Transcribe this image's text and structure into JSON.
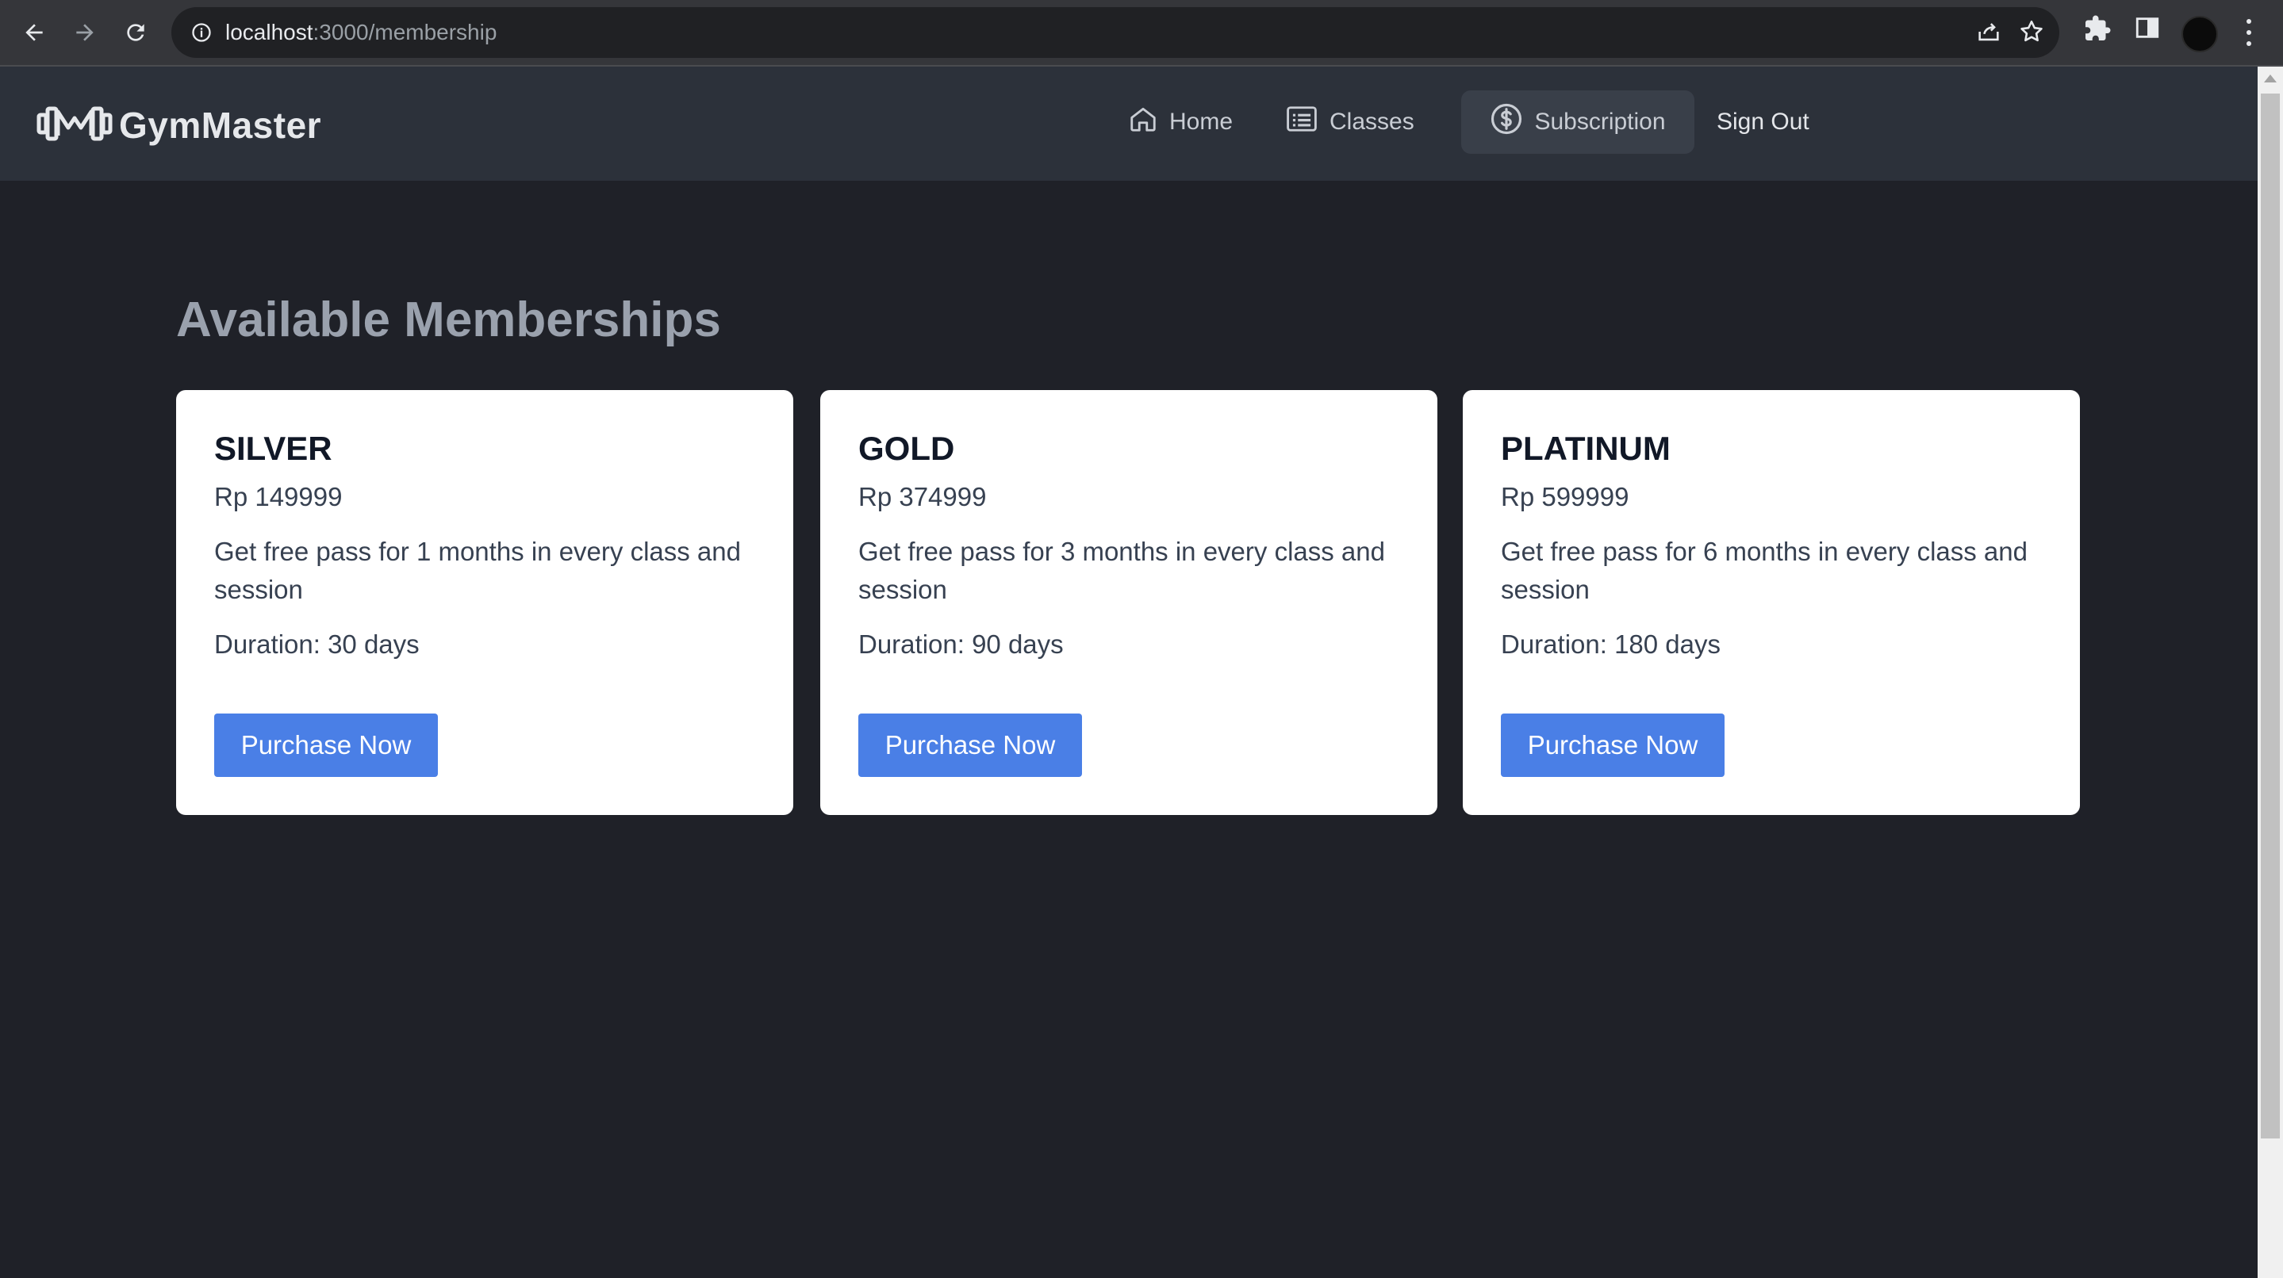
{
  "browser": {
    "url_host": "localhost",
    "url_path": ":3000/membership",
    "icons": [
      "back-icon",
      "forward-icon",
      "reload-icon",
      "info-icon",
      "share-icon",
      "star-icon",
      "extensions-icon",
      "side-panel-icon",
      "menu-icon"
    ]
  },
  "navbar": {
    "brand": "GymMaster",
    "links": [
      {
        "label": "Home",
        "icon": "home-icon"
      },
      {
        "label": "Classes",
        "icon": "list-icon"
      },
      {
        "label": "Subscription",
        "icon": "dollar-icon",
        "active": true
      },
      {
        "label": "Sign Out"
      }
    ]
  },
  "main": {
    "title": "Available Memberships",
    "plans": [
      {
        "name": "SILVER",
        "price": "Rp 149999",
        "description": "Get free pass for 1 months in every class and session",
        "duration": "Duration: 30 days",
        "button": "Purchase Now"
      },
      {
        "name": "GOLD",
        "price": "Rp 374999",
        "description": "Get free pass for 3 months in every class and session",
        "duration": "Duration: 90 days",
        "button": "Purchase Now"
      },
      {
        "name": "PLATINUM",
        "price": "Rp 599999",
        "description": "Get free pass for 6 months in every class and session",
        "duration": "Duration: 180 days",
        "button": "Purchase Now"
      }
    ]
  },
  "colors": {
    "page_bg": "#1f2128",
    "navbar_bg": "#2c313a",
    "card_bg": "#ffffff",
    "button_bg": "#4a7fe6"
  }
}
